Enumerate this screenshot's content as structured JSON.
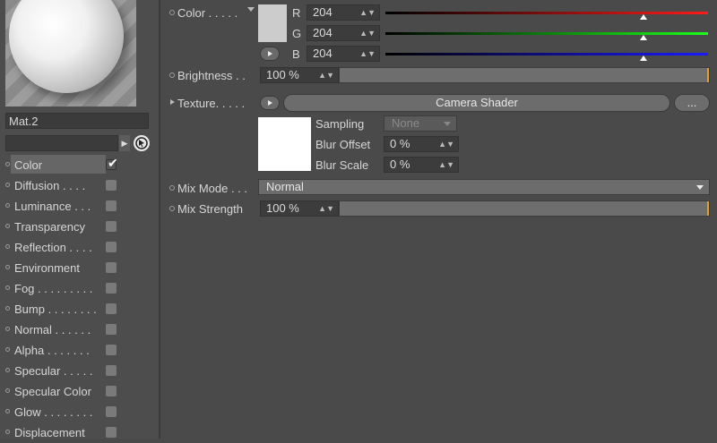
{
  "material": {
    "name": "Mat.2",
    "search_value": ""
  },
  "channels": [
    {
      "label": "Color",
      "checked": true
    },
    {
      "label": "Diffusion . . . .",
      "checked": false
    },
    {
      "label": "Luminance . . .",
      "checked": false
    },
    {
      "label": "Transparency",
      "checked": false
    },
    {
      "label": "Reflection . . . .",
      "checked": false
    },
    {
      "label": "Environment",
      "checked": false
    },
    {
      "label": "Fog . . . . . . . . .",
      "checked": false
    },
    {
      "label": "Bump . . . . . . . .",
      "checked": false
    },
    {
      "label": "Normal . . . . . .",
      "checked": false
    },
    {
      "label": "Alpha . . . . . . .",
      "checked": false
    },
    {
      "label": "Specular . . . . .",
      "checked": false
    },
    {
      "label": "Specular Color",
      "checked": false
    },
    {
      "label": "Glow . . . . . . . .",
      "checked": false
    },
    {
      "label": "Displacement",
      "checked": false
    }
  ],
  "color": {
    "label": "Color . . . . .",
    "swatch_color": "#cccccc",
    "r_label": "R",
    "r_value": "204",
    "g_label": "G",
    "g_value": "204",
    "b_label": "B",
    "b_value": "204",
    "r_fraction": 0.8,
    "g_fraction": 0.8,
    "b_fraction": 0.8
  },
  "brightness": {
    "label": "Brightness . .",
    "value": "100 %"
  },
  "texture": {
    "label": "Texture. . . . .",
    "shader_button": "Camera Shader",
    "more_button": "...",
    "sampling_label": "Sampling",
    "sampling_value": "None",
    "blur_offset_label": "Blur Offset",
    "blur_offset_value": "0 %",
    "blur_scale_label": "Blur Scale",
    "blur_scale_value": "0 %"
  },
  "mix_mode": {
    "label": "Mix Mode . . .",
    "value": "Normal"
  },
  "mix_strength": {
    "label": "Mix Strength",
    "value": "100 %"
  }
}
